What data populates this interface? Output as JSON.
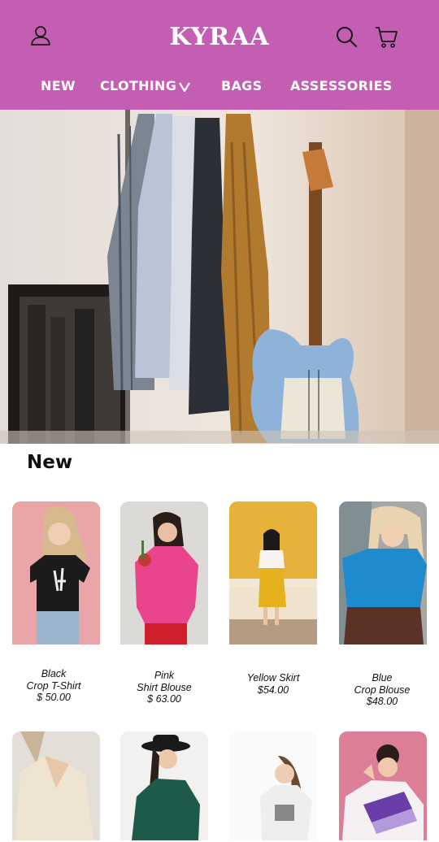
{
  "brand": {
    "name": "KYRAA",
    "color": "#c45eb3"
  },
  "header_icons": [
    "user-icon",
    "search-icon",
    "cart-icon"
  ],
  "nav": {
    "items": [
      {
        "label": "NEW"
      },
      {
        "label": "CLOTHING"
      },
      {
        "label": "BAGS"
      },
      {
        "label": "ASSESSORIES"
      }
    ],
    "clothing_chevron": "chevron-down-icon"
  },
  "section": {
    "title": "New"
  },
  "products": [
    {
      "name_line1": "Black",
      "name_line2": "Crop T-Shirt",
      "price": "$ 50.00"
    },
    {
      "name_line1": "Pink",
      "name_line2": "Shirt Blouse",
      "price": "$ 63.00"
    },
    {
      "name_line1": "Yellow Skirt",
      "name_line2": "",
      "price": "$54.00"
    },
    {
      "name_line1": "Blue",
      "name_line2": "Crop Blouse",
      "price": "$48.00"
    }
  ]
}
